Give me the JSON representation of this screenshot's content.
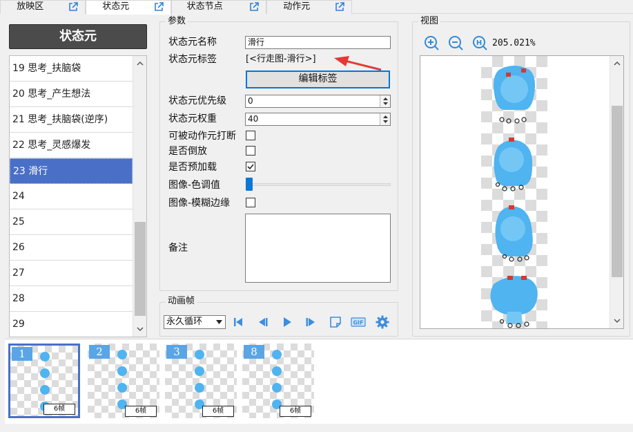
{
  "tabs": [
    {
      "label": "放映区"
    },
    {
      "label": "状态元"
    },
    {
      "label": "状态节点"
    },
    {
      "label": "动作元"
    }
  ],
  "left_panel": {
    "title": "状态元",
    "items": [
      {
        "label": "19 思考_扶脑袋"
      },
      {
        "label": "20 思考_产生想法"
      },
      {
        "label": "21 思考_扶脑袋(逆序)"
      },
      {
        "label": "22 思考_灵感爆发"
      },
      {
        "label": "23 滑行"
      },
      {
        "label": "24"
      },
      {
        "label": "25"
      },
      {
        "label": "26"
      },
      {
        "label": "27"
      },
      {
        "label": "28"
      },
      {
        "label": "29"
      }
    ],
    "selected_index": 4
  },
  "params": {
    "group_title": "参数",
    "name_label": "状态元名称",
    "name_value": "滑行",
    "tag_label": "状态元标签",
    "tag_value": "[<行走图-滑行>]",
    "edit_tag_button": "编辑标签",
    "priority_label": "状态元优先级",
    "priority_value": "0",
    "weight_label": "状态元权重",
    "weight_value": "40",
    "interruptible_label": "可被动作元打断",
    "interruptible_checked": false,
    "reverse_label": "是否倒放",
    "reverse_checked": false,
    "preload_label": "是否预加载",
    "preload_checked": true,
    "hue_label": "图像-色调值",
    "hue_value": 0,
    "blur_label": "图像-模糊边缘",
    "blur_checked": false,
    "note_label": "备注",
    "note_value": ""
  },
  "anim": {
    "group_title": "动画帧",
    "loop_value": "永久循环",
    "icons": [
      "first-frame-icon",
      "prev-frame-icon",
      "play-icon",
      "next-frame-icon",
      "new-frame-icon",
      "gif-icon",
      "settings-gear-icon"
    ]
  },
  "view": {
    "group_title": "视图",
    "zoom_text": "205.021%",
    "icons": [
      "zoom-in-icon",
      "zoom-out-icon",
      "zoom-reset-icon"
    ]
  },
  "frames": [
    {
      "num": "1",
      "count": "6帧"
    },
    {
      "num": "2",
      "count": "6帧"
    },
    {
      "num": "3",
      "count": "6帧"
    },
    {
      "num": "8",
      "count": "6帧"
    }
  ],
  "colors": {
    "accent": "#4a6fc6",
    "sprite": "#4fb4f0",
    "bow": "#d33a2c",
    "arrow": "#e53935"
  }
}
